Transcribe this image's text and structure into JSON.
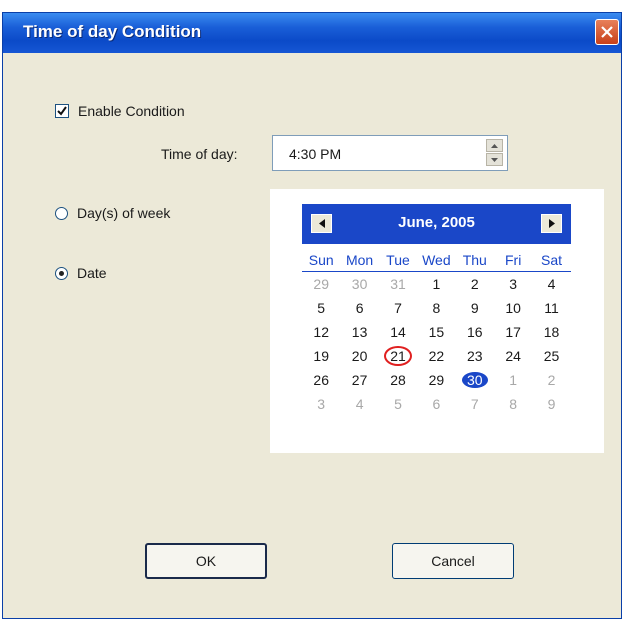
{
  "window": {
    "title": "Time of day Condition"
  },
  "enable_condition": {
    "label": "Enable Condition",
    "checked": true
  },
  "time_of_day": {
    "label": "Time of day:",
    "value": "4:30 PM"
  },
  "mode": {
    "days_of_week": {
      "label": "Day(s) of week",
      "selected": false
    },
    "date": {
      "label": "Date",
      "selected": true
    }
  },
  "calendar": {
    "month_label": "June, 2005",
    "days_of_week": [
      "Sun",
      "Mon",
      "Tue",
      "Wed",
      "Thu",
      "Fri",
      "Sat"
    ],
    "weeks": [
      [
        "29",
        "30",
        "31",
        "1",
        "2",
        "3",
        "4"
      ],
      [
        "5",
        "6",
        "7",
        "8",
        "9",
        "10",
        "11"
      ],
      [
        "12",
        "13",
        "14",
        "15",
        "16",
        "17",
        "18"
      ],
      [
        "19",
        "20",
        "21",
        "22",
        "23",
        "24",
        "25"
      ],
      [
        "26",
        "27",
        "28",
        "29",
        "30",
        "1",
        "2"
      ],
      [
        "3",
        "4",
        "5",
        "6",
        "7",
        "8",
        "9"
      ]
    ],
    "today": "21",
    "selected": "30"
  },
  "buttons": {
    "ok": "OK",
    "cancel": "Cancel"
  },
  "colors": {
    "title_bar": "#0b4ac8",
    "calendar_header": "#1a47c8",
    "today_ring": "#e02020",
    "dialog_bg": "#ece9d8"
  }
}
